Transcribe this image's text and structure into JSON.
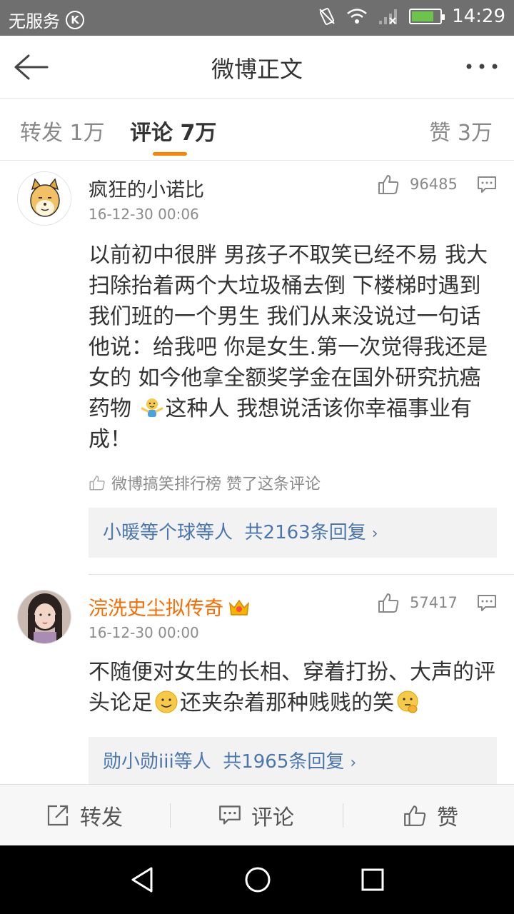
{
  "status_bar": {
    "carrier": "无服务",
    "carrier_badge": "K",
    "time": "14:29",
    "battery_level": 0.8
  },
  "nav": {
    "title": "微博正文"
  },
  "tabs": {
    "repost": "转发 1万",
    "comment": "评论 7万",
    "like": "赞 3万"
  },
  "comments": [
    {
      "name": "疯狂的小诺比",
      "time": "16-12-30 00:06",
      "likes": "96485",
      "text_parts": [
        "以前初中很胖  男孩子不取笑已经不易 我大扫除抬着两个大垃圾桶去倒  下楼梯时遇到我们班的一个男生 我们从来没说过一句话 他说：给我吧 你是女生.第一次觉得我还是女的 如今他拿全额奖学金在国外研究抗癌药物 ",
        "这种人 我想说活该你幸福事业有成！"
      ],
      "liked_by": "微博搞笑排行榜 赞了这条评论",
      "replies_users": "小暖等个球等人",
      "replies_count": "共2163条回复"
    },
    {
      "name": "浣洗史尘拟传奇",
      "time": "16-12-30 00:00",
      "likes": "57417",
      "text_parts": [
        "不随便对女生的长相、穿着打扮、大声的评头论足",
        "还夹杂着那种贱贱的笑"
      ],
      "replies_users": "勋小勋iii等人",
      "replies_count": "共1965条回复"
    }
  ],
  "toolbar": {
    "repost": "转发",
    "comment": "评论",
    "like": "赞"
  },
  "colors": {
    "accent": "#ff8200",
    "link": "#4b77ad",
    "vip_name": "#f86c00"
  }
}
